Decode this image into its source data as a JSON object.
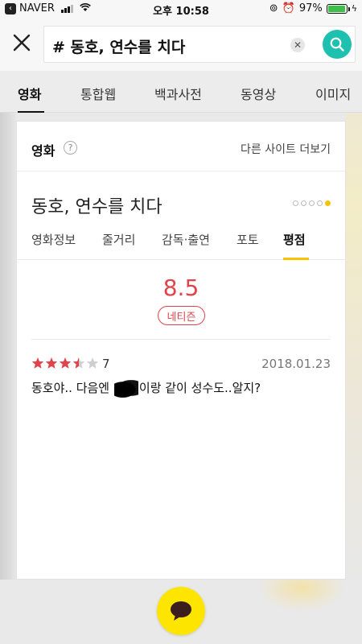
{
  "status_bar": {
    "carrier": "NAVER",
    "time": "오후 10:58",
    "battery": "97%",
    "battery_level": 0.97
  },
  "search": {
    "query": "# 동호, 연수를 치다"
  },
  "tabs": [
    {
      "label": "영화"
    },
    {
      "label": "통합웹"
    },
    {
      "label": "백과사전"
    },
    {
      "label": "동영상"
    },
    {
      "label": "이미지"
    }
  ],
  "card": {
    "title": "영화",
    "help": "?",
    "more": "다른 사이트 더보기",
    "movie_title": "동호, 연수를 치다",
    "subtabs": [
      {
        "label": "영화정보"
      },
      {
        "label": "줄거리"
      },
      {
        "label": "감독·출연"
      },
      {
        "label": "포토"
      },
      {
        "label": "평점"
      }
    ],
    "score": "8.5",
    "score_badge": "네티즌",
    "review": {
      "rating": "7",
      "star_fill": 3.5,
      "date": "2018.01.23",
      "text_before": "동호야.. 다음엔",
      "text_after": "이랑 같이 성수도..알지?"
    }
  },
  "colors": {
    "accent": "#1ec0b0",
    "highlight": "#f8c200",
    "score_red": "#e0434a",
    "kakao_yellow": "#fee500"
  }
}
